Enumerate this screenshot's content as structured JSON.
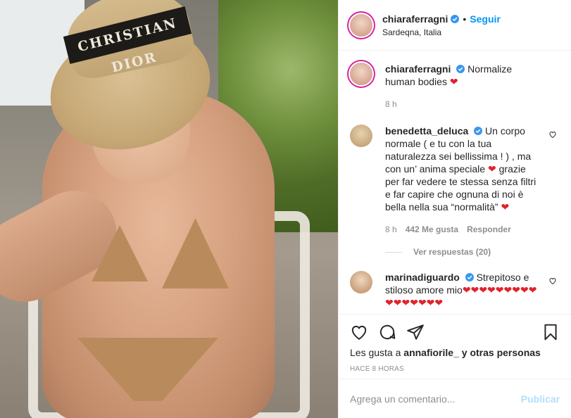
{
  "photo": {
    "hat_text": "CHRISTIAN DIOR"
  },
  "header": {
    "username": "chiaraferragni",
    "separator": "•",
    "follow_label": "Seguir",
    "location": "Sardeqna, Italia"
  },
  "caption": {
    "username": "chiaraferragni",
    "text": "Normalize human bodies",
    "emoji": "❤",
    "time": "8 h"
  },
  "comments": [
    {
      "username": "benedetta_deluca",
      "text": "Un corpo normale ( e tu con la tua naturalezza sei bellissima ! ) , ma con un’ anima speciale ❤ grazie per far vedere te stessa senza filtri e far capire che ognuna di noi è bella nella sua “normalità” ❤",
      "time": "8 h",
      "likes": "442 Me gusta",
      "reply_label": "Responder",
      "view_replies": "Ver respuestas (20)"
    },
    {
      "username": "marinadiguardo",
      "text": "Strepitoso e stiloso amore mio❤❤❤❤❤❤❤❤❤❤❤❤❤❤❤❤"
    }
  ],
  "likes": {
    "prefix": "Les gusta a",
    "user": "annafiorile_",
    "suffix": "y otras personas"
  },
  "timestamp": "HACE 8 HORAS",
  "add_comment": {
    "placeholder": "Agrega un comentario...",
    "post_label": "Publicar"
  },
  "colors": {
    "link_blue": "#0095f6",
    "verified_blue": "#3897f0",
    "heart_red": "#e0232b",
    "muted": "#8e8e8e"
  }
}
